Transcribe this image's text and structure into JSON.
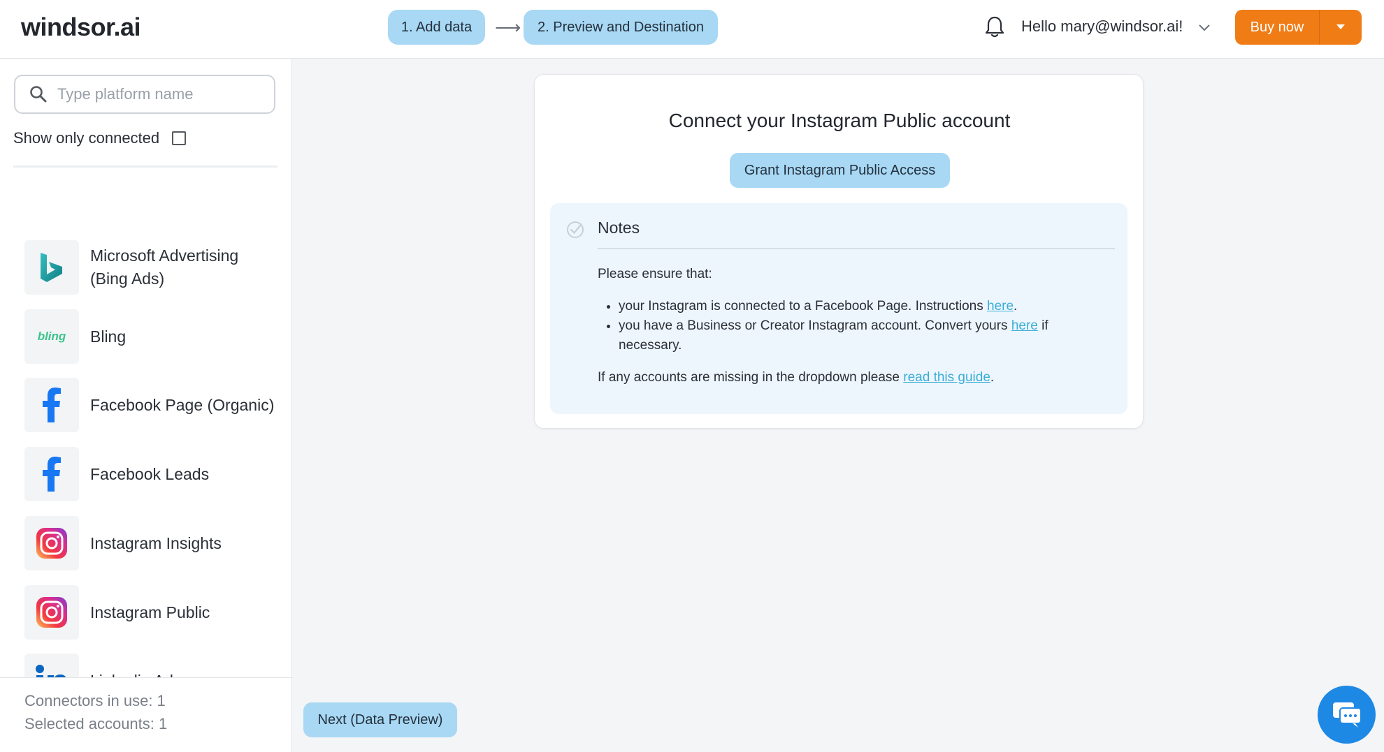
{
  "header": {
    "logo": "windsor.ai",
    "steps": [
      {
        "label": "1. Add data"
      },
      {
        "label": "2. Preview and Destination"
      }
    ],
    "arrow": "⟶",
    "greeting": "Hello mary@windsor.ai!",
    "buy_label": "Buy now",
    "accent_color": "#f07c16"
  },
  "sidebar": {
    "search_placeholder": "Type platform name",
    "show_connected_label": "Show only connected",
    "show_connected_checked": false,
    "platforms": [
      {
        "label": "Microsoft Advertising (Bing Ads)",
        "icon": "bing-icon"
      },
      {
        "label": "Bling",
        "icon": "bling-icon",
        "icon_text": "bling"
      },
      {
        "label": "Facebook Page (Organic)",
        "icon": "facebook-icon"
      },
      {
        "label": "Facebook Leads",
        "icon": "facebook-icon"
      },
      {
        "label": "Instagram Insights",
        "icon": "instagram-icon"
      },
      {
        "label": "Instagram Public",
        "icon": "instagram-icon"
      },
      {
        "label": "Linkedin Ads",
        "icon": "linkedin-icon"
      }
    ],
    "footer": {
      "connectors": "Connectors in use: 1",
      "selected": "Selected accounts: 1"
    }
  },
  "main": {
    "title": "Connect your Instagram Public account",
    "grant_label": "Grant Instagram Public Access",
    "notes": {
      "title": "Notes",
      "intro": "Please ensure that:",
      "item1_pre": "your Instagram is connected to a Facebook Page. Instructions ",
      "item1_link": "here",
      "item1_post": ".",
      "item2_pre": "you have a Business or Creator Instagram account. Convert yours ",
      "item2_link": "here",
      "item2_post": " if necessary.",
      "guide_pre": "If any accounts are missing in the dropdown please ",
      "guide_link": "read this guide",
      "guide_post": "."
    },
    "next_label": "Next (Data Preview)"
  }
}
